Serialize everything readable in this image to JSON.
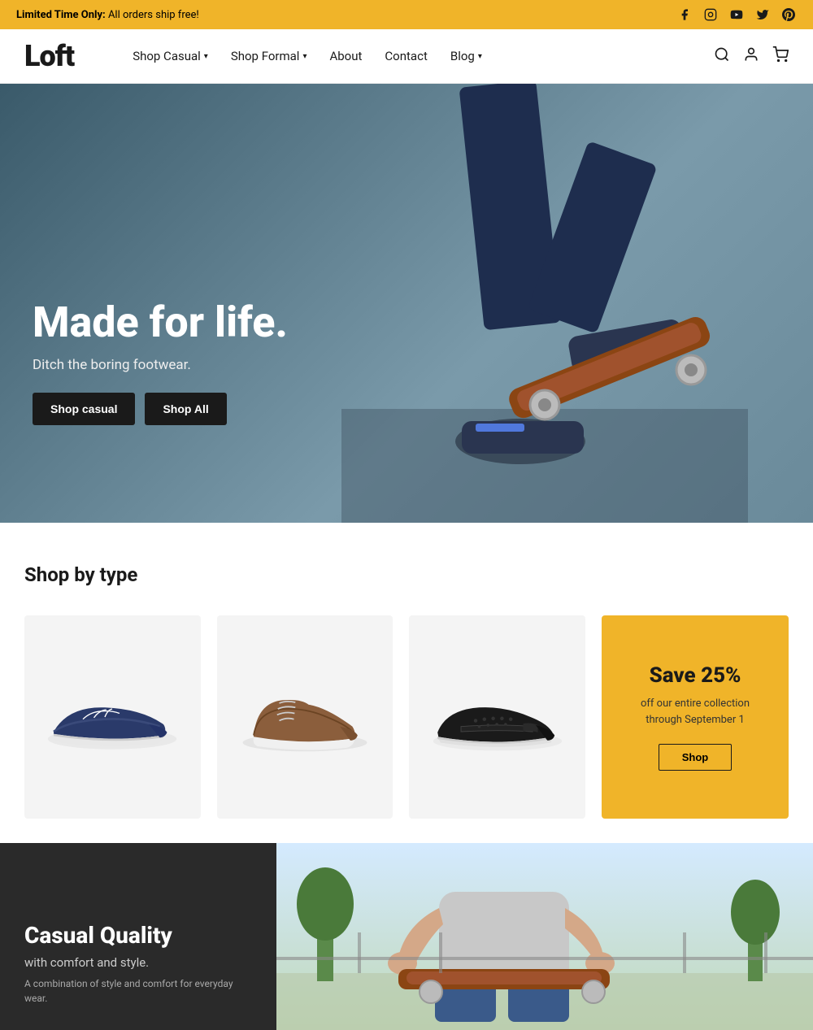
{
  "announcement": {
    "prefix": "Limited Time Only:",
    "message": " All orders ship free!",
    "social_icons": [
      "facebook",
      "instagram",
      "youtube",
      "twitter",
      "pinterest"
    ]
  },
  "header": {
    "logo": "Loft",
    "nav": [
      {
        "label": "Shop Casual",
        "hasDropdown": true
      },
      {
        "label": "Shop Formal",
        "hasDropdown": true
      },
      {
        "label": "About",
        "hasDropdown": false
      },
      {
        "label": "Contact",
        "hasDropdown": false
      },
      {
        "label": "Blog",
        "hasDropdown": true
      }
    ],
    "actions": [
      "search",
      "account",
      "cart"
    ]
  },
  "hero": {
    "title": "Made for life.",
    "subtitle": "Ditch the boring footwear.",
    "cta_primary": "Shop casual",
    "cta_secondary": "Shop All"
  },
  "shop_section": {
    "title": "Shop by type",
    "products": [
      {
        "name": "Navy Casual Sneaker",
        "color": "#e8e8e8"
      },
      {
        "name": "Brown Mid Sneaker",
        "color": "#f0ece8"
      },
      {
        "name": "Black Leather Casual",
        "color": "#e8e8e8"
      }
    ],
    "promo": {
      "title": "Save 25%",
      "description": "off our entire collection through September 1",
      "button": "Shop"
    }
  },
  "casual_section": {
    "title": "Casual Quality",
    "subtitle": "with comfort and style.",
    "description": "A combination of style and comfort for everyday wear."
  }
}
